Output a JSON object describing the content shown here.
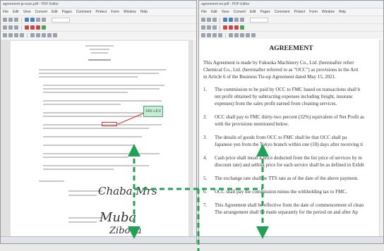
{
  "left_pane": {
    "title": "agreement-ja-scan.pdf - PDF Editor",
    "menu": [
      "File",
      "Edit",
      "View",
      "Convert",
      "Edit",
      "Pages",
      "Comment",
      "Protect",
      "Form",
      "Window",
      "Help"
    ],
    "callout": "FAX v.8.3"
  },
  "right_pane": {
    "title": "agreement-en.pdf - PDF Editor",
    "menu": [
      "File",
      "Edit",
      "View",
      "Convert",
      "Edit",
      "Pages",
      "Comment",
      "Protect",
      "Form",
      "Window",
      "Help"
    ],
    "heading": "AGREEMENT",
    "intro": [
      "This Agreement is made by Fukuoka Machinery Co., Ltd. (hereinafter referr",
      "Chemical Co., Ltd. (hereinafter referred to as \"OCC\") as provisions in the Arti",
      "in Article 6 of the Business Tie-up Agreement dated May 15, 2021."
    ],
    "clauses": [
      {
        "num": "1.",
        "lines": [
          "The commission to be paid by OCC to FMC based on transactions shall b",
          "net profit obtained by subtracting expenses including freight, insuranc",
          "expenses) from the sales profit earned from cleaning services."
        ]
      },
      {
        "num": "2.",
        "lines": [
          "OCC shall pay to FMC thirty-two percent (32%) equivalent of Net Profit as",
          "with the provisions mentioned below."
        ]
      },
      {
        "num": "3.",
        "lines": [
          "The details of goods from OCC to FMC shall be that OCC shall pa",
          "Japanese yen from the Tokyo branch within one (10) days after receiving ti"
        ]
      },
      {
        "num": "4.",
        "lines": [
          "Cash price shall mean a price deducted from the list price of services by m",
          "discount rate) and selling price for each service shall be as defined in Exhib"
        ]
      },
      {
        "num": "5.",
        "lines": [
          "The exchange rate shall be TTS rate as of the date of the above payment."
        ]
      },
      {
        "num": "6.",
        "lines": [
          "OCC shall pay the commission minus the withholding tax to FMC."
        ]
      },
      {
        "num": "7.",
        "lines": [
          "This Agreement shall be effective from the date of commencement of clean",
          "The arrangement shall be made separately for the period on and after Ap"
        ]
      }
    ]
  },
  "colors": {
    "arrow": "#22a155",
    "callout_border": "#3fae6b",
    "highlight_box": "#e03131"
  }
}
